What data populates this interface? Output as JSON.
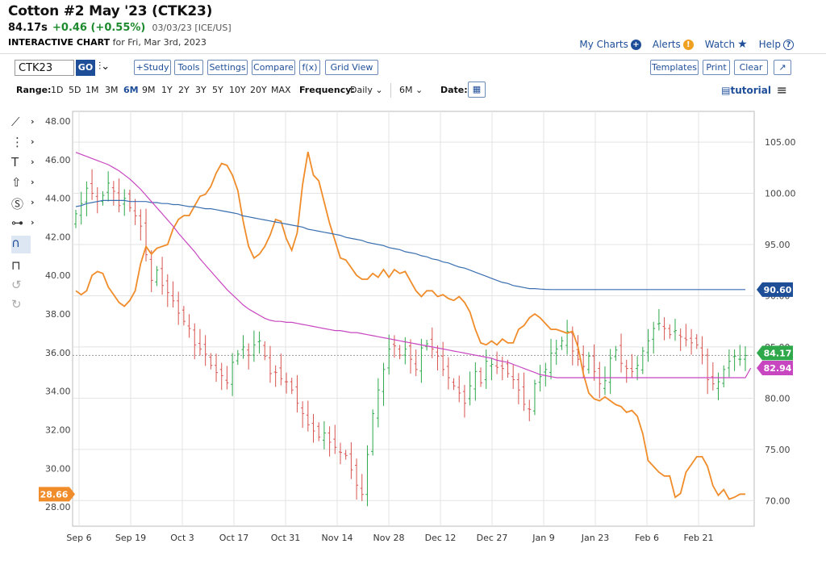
{
  "header": {
    "title": "Cotton #2 May '23 (CTK23)",
    "last": "84.17s",
    "change": "+0.46 (+0.55%)",
    "meta": "03/03/23 [ICE/US]",
    "sub_bold": "INTERACTIVE CHART",
    "sub_rest": "for Fri, Mar 3rd, 2023"
  },
  "toplinks": {
    "my_charts": "My Charts",
    "alerts": "Alerts",
    "watch": "Watch",
    "help": "Help"
  },
  "toolbar": {
    "symbol": "CTK23",
    "go": "GO",
    "study": "+Study",
    "tools": "Tools",
    "settings": "Settings",
    "compare": "Compare",
    "fx": "f(x)",
    "grid_view": "Grid View",
    "templates": "Templates",
    "print": "Print",
    "clear": "Clear"
  },
  "rangebar": {
    "range_label": "Range:",
    "ranges": [
      "1D",
      "5D",
      "1M",
      "3M",
      "6M",
      "9M",
      "1Y",
      "2Y",
      "3Y",
      "5Y",
      "10Y",
      "20Y",
      "MAX"
    ],
    "selected": "6M",
    "frequency_label": "Frequency:",
    "frequency": "Daily",
    "period": "6M",
    "date_label": "Date:",
    "tutorial": "tutorial"
  },
  "colors": {
    "accent": "#1f4e99",
    "up": "#2ea84a",
    "down": "#d9534f",
    "compare_line": "#f08c2a",
    "ma_long": "#3a6fb0",
    "ma_short": "#c846c0"
  },
  "chart_data": {
    "type": "line",
    "x_ticks": [
      "Sep 6",
      "Sep 19",
      "Oct 3",
      "Oct 17",
      "Oct 31",
      "Nov 14",
      "Nov 28",
      "Dec 12",
      "Dec 27",
      "Jan 9",
      "Jan 23",
      "Feb 6",
      "Feb 21"
    ],
    "left_axis": {
      "ticks": [
        "48.00",
        "46.00",
        "44.00",
        "42.00",
        "40.00",
        "38.00",
        "36.00",
        "34.00",
        "32.00",
        "30.00",
        "28.00"
      ],
      "ylim": [
        27,
        48.5
      ]
    },
    "right_axis": {
      "ticks": [
        "105.00",
        "100.00",
        "95.00",
        "90.00",
        "85.00",
        "80.00",
        "75.00",
        "70.00"
      ],
      "ylim": [
        67.5,
        108
      ]
    },
    "badges": {
      "compare_last": "28.66",
      "ma_long_last": "90.60",
      "price_last": "84.17",
      "ma_short_last": "82.94"
    },
    "series": [
      {
        "kind": "ohlc",
        "axis": "right",
        "x_range": [
          0,
          124
        ],
        "closes": [
          98,
          99,
          100.5,
          100,
          99.2,
          99.8,
          101,
          100.2,
          98.8,
          99.5,
          98.6,
          97.8,
          96.8,
          94,
          91.5,
          92.5,
          91,
          90.3,
          89.5,
          88.3,
          87.5,
          86.8,
          85.2,
          84.8,
          84.3,
          83.2,
          82.5,
          82.2,
          81.5,
          83.5,
          84.3,
          85,
          84.2,
          85.2,
          85.6,
          84.1,
          82.4,
          82.5,
          81.9,
          81.6,
          80.8,
          79.5,
          78.5,
          77.4,
          76.8,
          76.2,
          76.6,
          75.7,
          75.2,
          74.7,
          74.4,
          73,
          71.5,
          70.6,
          74.5,
          78.5,
          80.8,
          82.8,
          84.8,
          85.1,
          84.2,
          84.8,
          83.8,
          82.8,
          84.9,
          85.3,
          84.8,
          84.1,
          82.8,
          82,
          81.2,
          80.5,
          79.5,
          81.2,
          82.6,
          81.5,
          83.6,
          83.3,
          83,
          82.9,
          82.4,
          81.8,
          80.8,
          79.4,
          78.9,
          81.4,
          82.1,
          82.8,
          84.4,
          84.8,
          85.6,
          86.5,
          84.6,
          83.8,
          83.1,
          84.1,
          82.6,
          81.4,
          81.7,
          83.9,
          84.7,
          83.4,
          82.9,
          82.6,
          83.2,
          84.6,
          85.6,
          86.8,
          87.3,
          86.8,
          86.2,
          86.6,
          86,
          85.7,
          85.4,
          85.2,
          84.2,
          81.8,
          81.4,
          81.6,
          82.8,
          83.6,
          84.1,
          83.8,
          84.17
        ]
      },
      {
        "name": "",
        "kind": "line",
        "axis": "left",
        "x_range": [
          0,
          124
        ],
        "values": [
          39.2,
          39,
          39.2,
          40,
          40.2,
          40.1,
          39.4,
          39,
          38.6,
          38.4,
          38.7,
          39.2,
          40.6,
          41.5,
          41.1,
          41.4,
          41.5,
          41.6,
          42.4,
          42.9,
          43.1,
          43.1,
          43.6,
          44.1,
          44.2,
          44.6,
          45.3,
          45.8,
          45.7,
          45.2,
          44.4,
          42.8,
          41.5,
          40.9,
          41.1,
          41.5,
          42.1,
          42.9,
          42.8,
          41.9,
          41.3,
          42.2,
          44.7,
          46.4,
          45.2,
          44.9,
          43.8,
          42.7,
          41.8,
          40.9,
          40.8,
          40.4,
          40,
          39.8,
          39.8,
          40.1,
          39.9,
          40.3,
          39.9,
          40.3,
          40.1,
          40.2,
          39.7,
          39.2,
          38.9,
          39.2,
          39.2,
          38.9,
          39,
          38.8,
          38.7,
          38.9,
          38.6,
          38.1,
          37.2,
          36.5,
          36.4,
          36.6,
          36.4,
          36.7,
          36.5,
          36.5,
          37.2,
          37.4,
          37.8,
          38,
          37.8,
          37.5,
          37.2,
          37.2,
          37.1,
          37,
          37.1,
          36.3,
          34.9,
          33.9,
          33.6,
          33.5,
          33.7,
          33.5,
          33.3,
          33.2,
          32.9,
          33,
          32.7,
          31.8,
          30.4,
          30.1,
          29.8,
          29.6,
          29.6,
          28.5,
          28.7,
          29.8,
          30.2,
          30.6,
          30.6,
          30.1,
          29.1,
          28.6,
          28.9,
          28.4,
          28.5,
          28.66,
          28.66
        ]
      },
      {
        "name": "",
        "kind": "line",
        "axis": "right",
        "x_range": [
          0,
          124
        ],
        "values": [
          98.7,
          98.8,
          99,
          99.1,
          99.2,
          99.3,
          99.3,
          99.3,
          99.3,
          99.3,
          99.2,
          99.2,
          99.2,
          99.2,
          99.1,
          99.1,
          99,
          99,
          98.9,
          98.9,
          98.8,
          98.7,
          98.7,
          98.6,
          98.5,
          98.5,
          98.4,
          98.3,
          98.2,
          98.1,
          98,
          97.8,
          97.7,
          97.6,
          97.5,
          97.4,
          97.3,
          97.2,
          97.1,
          97,
          96.9,
          96.8,
          96.7,
          96.5,
          96.4,
          96.3,
          96.2,
          96.1,
          96,
          95.9,
          95.7,
          95.6,
          95.5,
          95.4,
          95.2,
          95.1,
          95,
          94.9,
          94.7,
          94.6,
          94.5,
          94.3,
          94.2,
          94.1,
          93.9,
          93.8,
          93.6,
          93.5,
          93.3,
          93.2,
          93,
          92.8,
          92.7,
          92.5,
          92.3,
          92.1,
          91.9,
          91.7,
          91.5,
          91.3,
          91.2,
          91,
          90.9,
          90.8,
          90.7,
          90.7,
          90.65,
          90.62,
          90.6,
          90.6,
          90.6,
          90.6,
          90.6,
          90.6,
          90.6,
          90.6,
          90.6,
          90.6,
          90.6,
          90.6,
          90.6,
          90.6,
          90.6,
          90.6,
          90.6,
          90.6,
          90.6,
          90.6,
          90.6,
          90.6,
          90.6,
          90.6,
          90.6,
          90.6,
          90.6,
          90.6,
          90.6,
          90.6,
          90.6,
          90.6,
          90.6,
          90.6,
          90.6,
          90.6,
          90.6
        ]
      },
      {
        "name": "",
        "kind": "line",
        "axis": "right",
        "x_range": [
          0,
          124
        ],
        "values": [
          104,
          103.8,
          103.6,
          103.4,
          103.2,
          103,
          102.8,
          102.5,
          102.2,
          101.8,
          101.4,
          100.9,
          100.4,
          99.8,
          99.2,
          98.6,
          98,
          97.4,
          96.8,
          96.1,
          95.5,
          94.9,
          94.3,
          93.6,
          93,
          92.4,
          91.8,
          91.2,
          90.6,
          90.1,
          89.6,
          89.1,
          88.7,
          88.4,
          88.1,
          87.8,
          87.6,
          87.5,
          87.5,
          87.4,
          87.4,
          87.3,
          87.2,
          87.1,
          87,
          86.9,
          86.8,
          86.7,
          86.6,
          86.6,
          86.5,
          86.4,
          86.4,
          86.3,
          86.2,
          86.1,
          86,
          85.9,
          85.8,
          85.7,
          85.6,
          85.5,
          85.4,
          85.3,
          85.2,
          85.1,
          85,
          84.9,
          84.8,
          84.7,
          84.6,
          84.5,
          84.4,
          84.3,
          84.2,
          84.1,
          84,
          83.9,
          83.7,
          83.6,
          83.5,
          83.3,
          83.1,
          82.9,
          82.7,
          82.5,
          82.3,
          82.2,
          82.1,
          82,
          82,
          82,
          82,
          82,
          82,
          82,
          82,
          82,
          82,
          82,
          82,
          82,
          82,
          82,
          82,
          82,
          82,
          82,
          82,
          82,
          82,
          82,
          82,
          82,
          82,
          82,
          82,
          82,
          82,
          82,
          82,
          82,
          82,
          82,
          82,
          82.94
        ]
      }
    ]
  }
}
